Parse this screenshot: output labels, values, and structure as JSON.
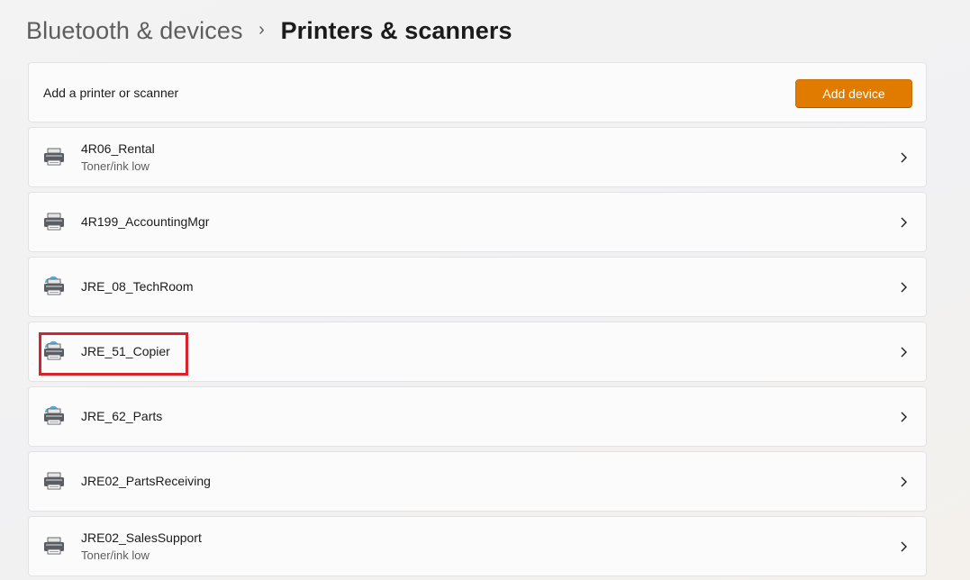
{
  "breadcrumb": {
    "parent": "Bluetooth & devices",
    "separator": "›",
    "current": "Printers & scanners"
  },
  "add_printer": {
    "label": "Add a printer or scanner",
    "button_label": "Add device"
  },
  "colors": {
    "accent": "#e07b00",
    "highlight": "#d8232a"
  },
  "printers": [
    {
      "name": "4R06_Rental",
      "status": "Toner/ink low",
      "icon": "printer-icon"
    },
    {
      "name": "4R199_AccountingMgr",
      "status": "",
      "icon": "printer-icon"
    },
    {
      "name": "JRE_08_TechRoom",
      "status": "",
      "icon": "network-printer-icon"
    },
    {
      "name": "JRE_51_Copier",
      "status": "",
      "icon": "network-printer-icon"
    },
    {
      "name": "JRE_62_Parts",
      "status": "",
      "icon": "network-printer-icon"
    },
    {
      "name": "JRE02_PartsReceiving",
      "status": "",
      "icon": "printer-icon"
    },
    {
      "name": "JRE02_SalesSupport",
      "status": "Toner/ink low",
      "icon": "printer-icon"
    }
  ]
}
